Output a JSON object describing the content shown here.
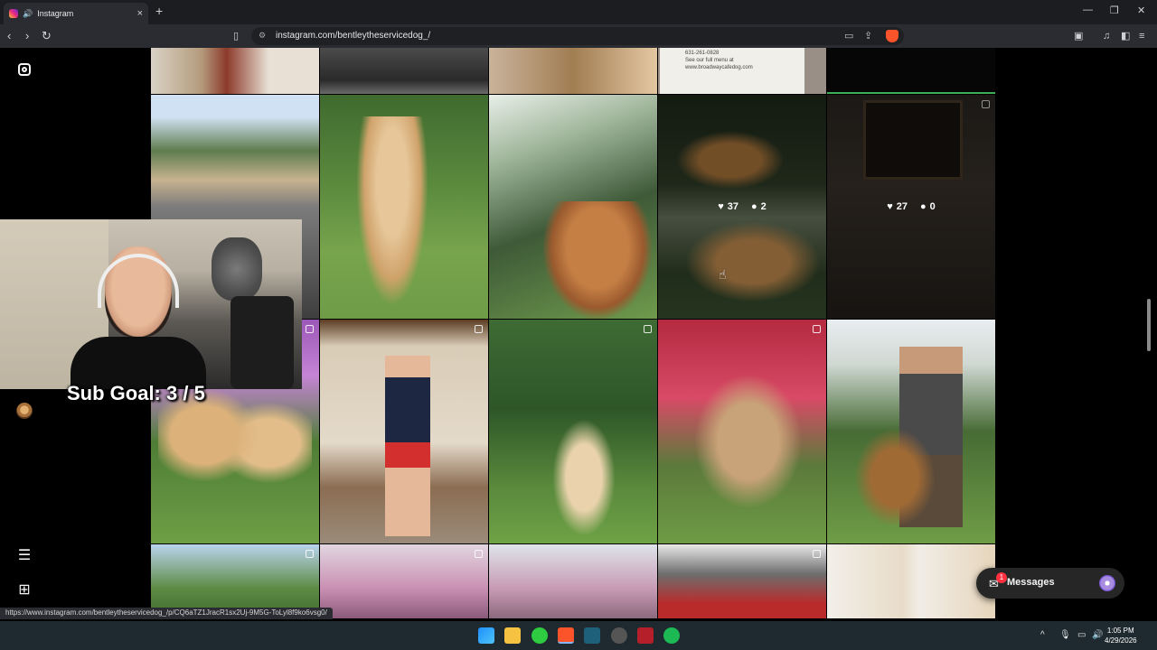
{
  "browser": {
    "tab_title": "Instagram",
    "new_tab": "+",
    "url": "instagram.com/bentleytheservicedog_/",
    "status_url": "https://www.instagram.com/bentleytheservicedog_/p/CQ6aTZ1JracR1sx2Uj-9M5G-ToLyl8f9ko6vsg0/",
    "controls": {
      "minimize": "—",
      "restore": "❐",
      "close": "✕"
    }
  },
  "post_hover": [
    {
      "likes": "37",
      "comments": "2"
    },
    {
      "likes": "27",
      "comments": "0"
    }
  ],
  "card_text": [
    "631-261-0828",
    "See our full menu at",
    "www.broadwaycafedog.com"
  ],
  "overlay": {
    "sub_goal": "Sub Goal: 3 / 5"
  },
  "messages": {
    "label": "Messages",
    "badge": "1"
  },
  "taskbar": {
    "time": "1:05 PM",
    "date": "4/29/2026"
  },
  "icons": {
    "instagram": "instagram-logo-icon",
    "heart": "heart-icon",
    "create": "plus-icon",
    "more": "menu-icon",
    "also_from_meta": "apps-grid-icon"
  }
}
